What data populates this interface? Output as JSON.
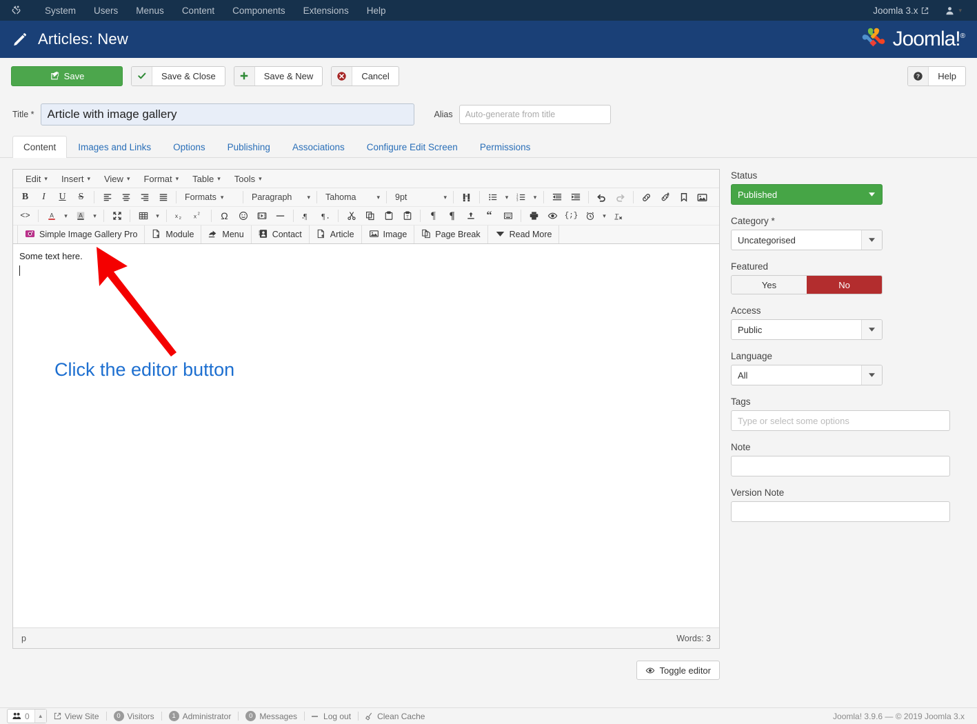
{
  "topbar": {
    "brand_icon": "joomla-logo-icon",
    "menu": [
      "System",
      "Users",
      "Menus",
      "Content",
      "Components",
      "Extensions",
      "Help"
    ],
    "site_link": "Joomla 3.x",
    "site_link_icon": "external-link-icon",
    "user_icon": "user-icon",
    "user_caret": "▾"
  },
  "header": {
    "icon": "pencil-icon",
    "title": "Articles: New",
    "logo_text": "Joomla!",
    "logo_reg": "®"
  },
  "toolbar": {
    "save": "Save",
    "save_icon": "pencil-square-icon",
    "save_close": "Save & Close",
    "save_close_icon": "check-icon",
    "save_new": "Save & New",
    "save_new_icon": "plus-icon",
    "cancel": "Cancel",
    "cancel_icon": "cancel-circle-icon",
    "help": "Help",
    "help_icon": "question-circle-icon"
  },
  "form": {
    "title_label": "Title *",
    "title_value": "Article with image gallery",
    "alias_label": "Alias",
    "alias_placeholder": "Auto-generate from title"
  },
  "tabs": [
    {
      "label": "Content",
      "active": true
    },
    {
      "label": "Images and Links",
      "active": false
    },
    {
      "label": "Options",
      "active": false
    },
    {
      "label": "Publishing",
      "active": false
    },
    {
      "label": "Associations",
      "active": false
    },
    {
      "label": "Configure Edit Screen",
      "active": false
    },
    {
      "label": "Permissions",
      "active": false
    }
  ],
  "editor": {
    "menubar": [
      "Edit",
      "Insert",
      "View",
      "Format",
      "Table",
      "Tools"
    ],
    "row1": {
      "bold": "B",
      "italic": "I",
      "underline": "U",
      "strikethrough": "S",
      "formats_label": "Formats",
      "paragraph_label": "Paragraph",
      "font_label": "Tahoma",
      "size_label": "9pt"
    },
    "body_text": "Some text here.",
    "annotation": "Click the editor button",
    "status_path": "p",
    "word_count": "Words: 3",
    "toggle_editor": "Toggle editor",
    "toggle_editor_icon": "eye-icon",
    "xtd_buttons": [
      {
        "label": "Simple Image Gallery Pro",
        "icon": "camera-icon"
      },
      {
        "label": "Module",
        "icon": "module-icon"
      },
      {
        "label": "Menu",
        "icon": "menu-share-icon"
      },
      {
        "label": "Contact",
        "icon": "contact-card-icon"
      },
      {
        "label": "Article",
        "icon": "article-icon"
      },
      {
        "label": "Image",
        "icon": "image-icon"
      },
      {
        "label": "Page Break",
        "icon": "page-break-icon"
      },
      {
        "label": "Read More",
        "icon": "read-more-icon"
      }
    ]
  },
  "sidebar": {
    "status_label": "Status",
    "status_value": "Published",
    "category_label": "Category *",
    "category_value": "Uncategorised",
    "featured_label": "Featured",
    "featured_yes": "Yes",
    "featured_no": "No",
    "access_label": "Access",
    "access_value": "Public",
    "language_label": "Language",
    "language_value": "All",
    "tags_label": "Tags",
    "tags_placeholder": "Type or select some options",
    "note_label": "Note",
    "note_value": "",
    "version_note_label": "Version Note",
    "version_note_value": ""
  },
  "footer": {
    "counter_value": "0",
    "counter_icon": "users-icon",
    "counter_caret": "▲",
    "items": [
      {
        "label": "View Site",
        "icon": "external-link-icon",
        "badge": null
      },
      {
        "label": "Visitors",
        "icon": null,
        "badge": "0"
      },
      {
        "label": "Administrator",
        "icon": null,
        "badge": "1"
      },
      {
        "label": "Messages",
        "icon": null,
        "badge": "0"
      },
      {
        "label": "Log out",
        "icon": "logout-icon",
        "badge": null
      },
      {
        "label": "Clean Cache",
        "icon": "broom-icon",
        "badge": null
      }
    ],
    "copyright": "Joomla! 3.9.6  —  © 2019 Joomla 3.x"
  },
  "colors": {
    "topbar_bg": "#16314c",
    "header_bg": "#1a4077",
    "save_green": "#4ca64c",
    "status_green": "#46a546",
    "featured_red": "#b32d2e",
    "link_blue": "#2a6fb8",
    "annotation_blue": "#1d6fd0",
    "arrow_red": "#f40000",
    "sgp_icon_magenta": "#b5167e"
  }
}
